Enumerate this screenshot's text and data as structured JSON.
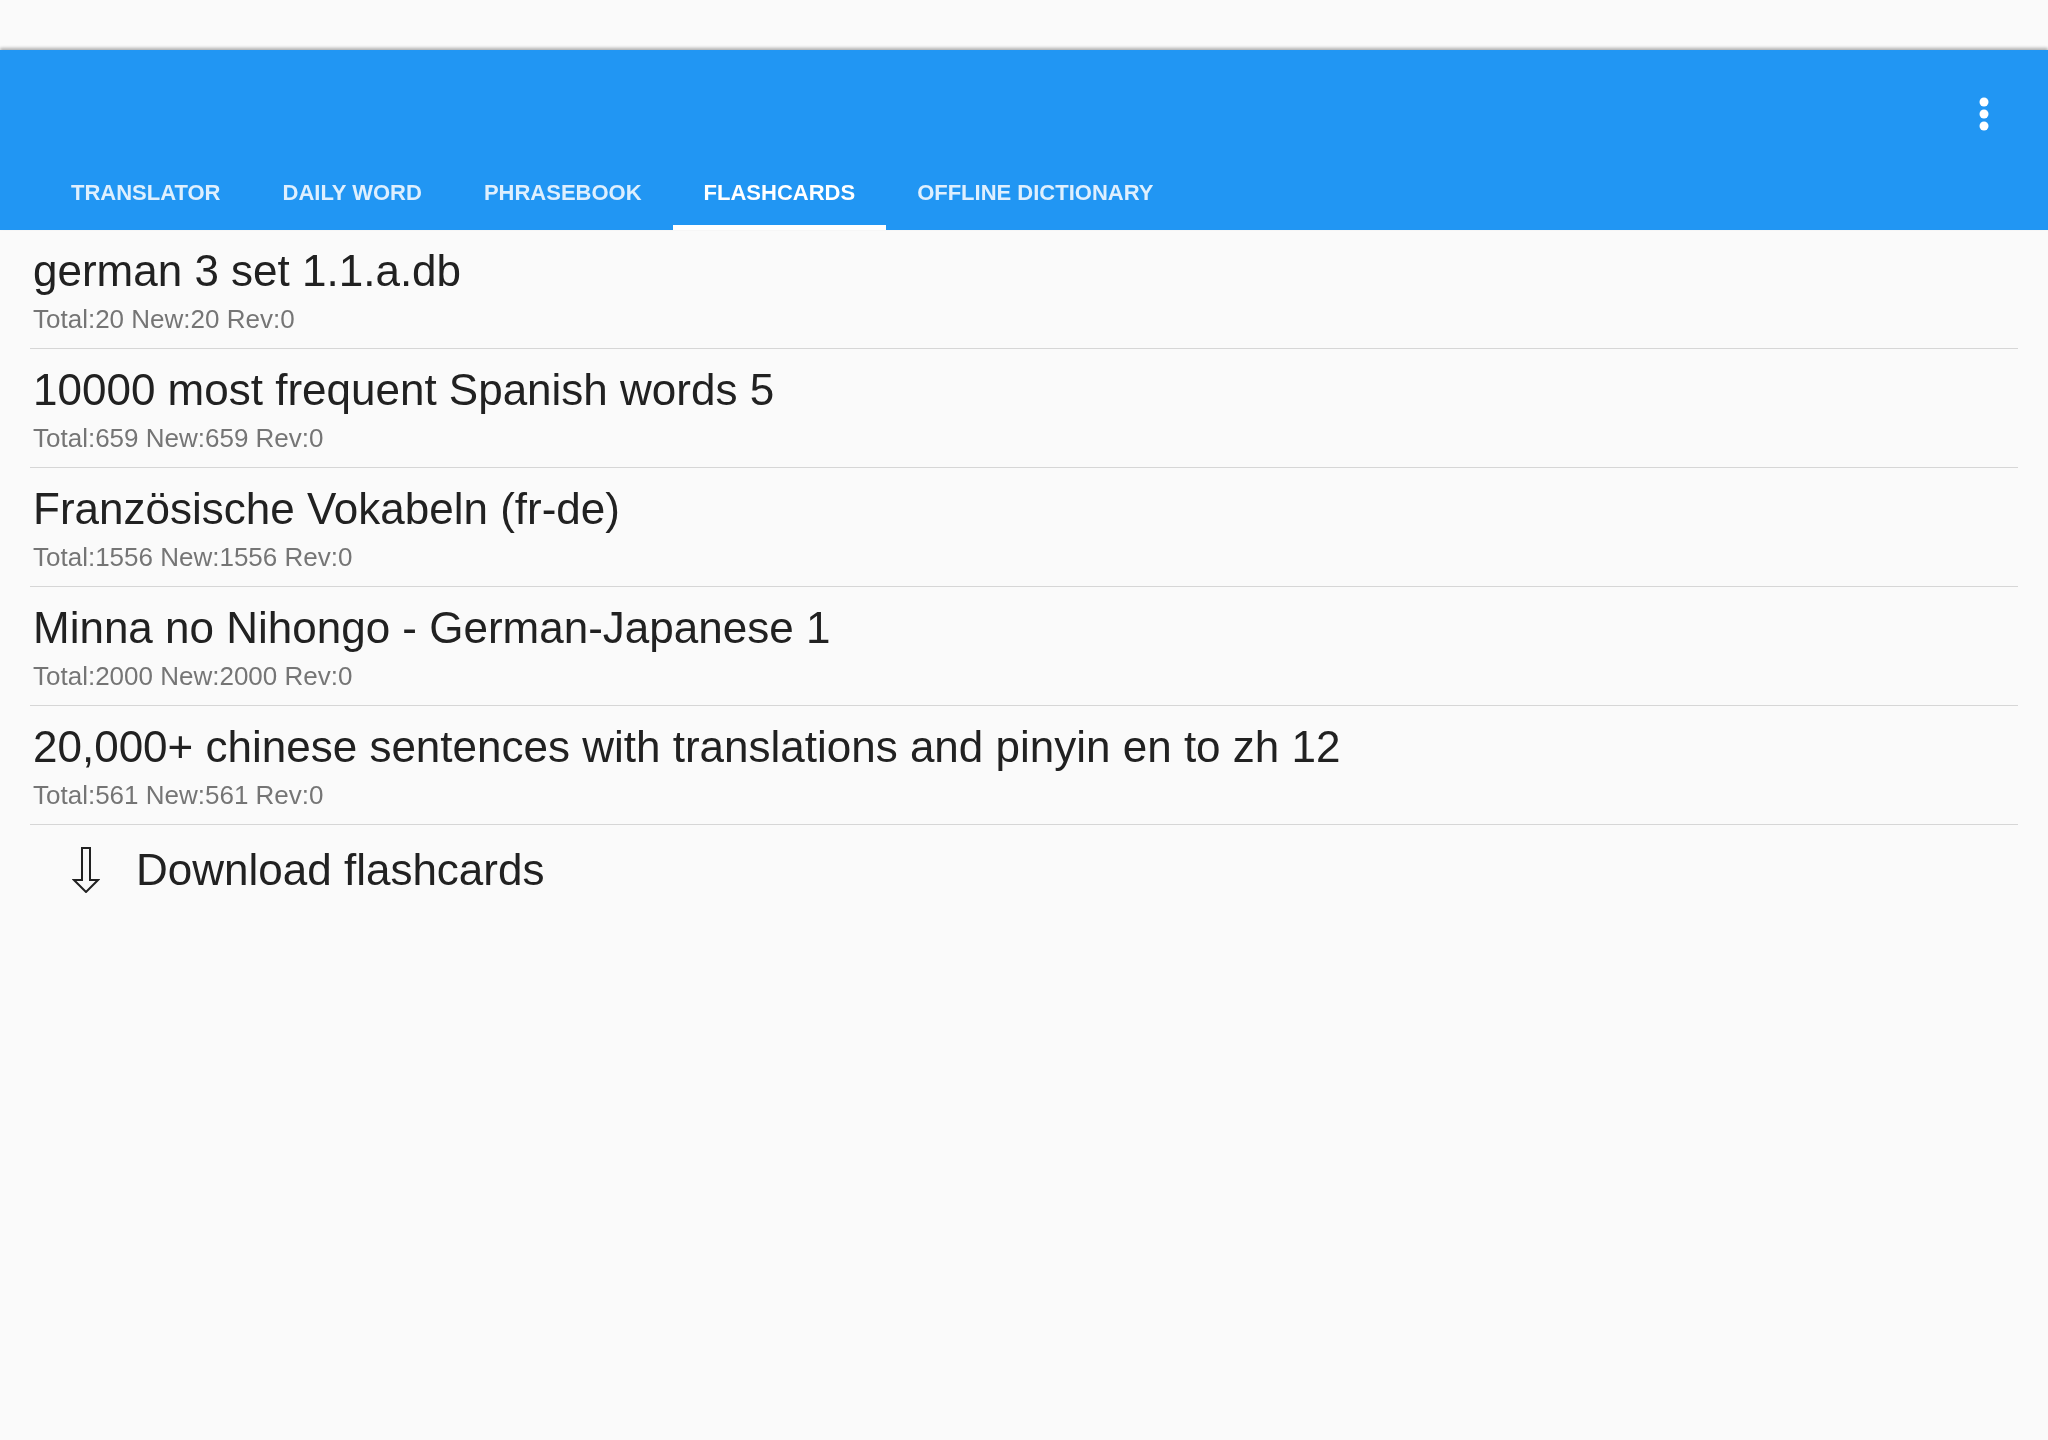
{
  "tabs": [
    {
      "label": "TRANSLATOR",
      "selected": false
    },
    {
      "label": "DAILY WORD",
      "selected": false
    },
    {
      "label": "PHRASEBOOK",
      "selected": false
    },
    {
      "label": "FLASHCARDS",
      "selected": true
    },
    {
      "label": "OFFLINE DICTIONARY",
      "selected": false
    }
  ],
  "decks": [
    {
      "title": "german 3 set 1.1.a.db",
      "stats": "Total:20 New:20 Rev:0"
    },
    {
      "title": "10000 most frequent Spanish words 5",
      "stats": "Total:659 New:659 Rev:0"
    },
    {
      "title": "Französische Vokabeln (fr-de)",
      "stats": "Total:1556 New:1556 Rev:0"
    },
    {
      "title": "Minna no Nihongo - German-Japanese 1",
      "stats": "Total:2000 New:2000 Rev:0"
    },
    {
      "title": "20,000+ chinese sentences with translations and pinyin en to zh 12",
      "stats": "Total:561 New:561 Rev:0"
    }
  ],
  "download": {
    "label": "Download flashcards"
  }
}
